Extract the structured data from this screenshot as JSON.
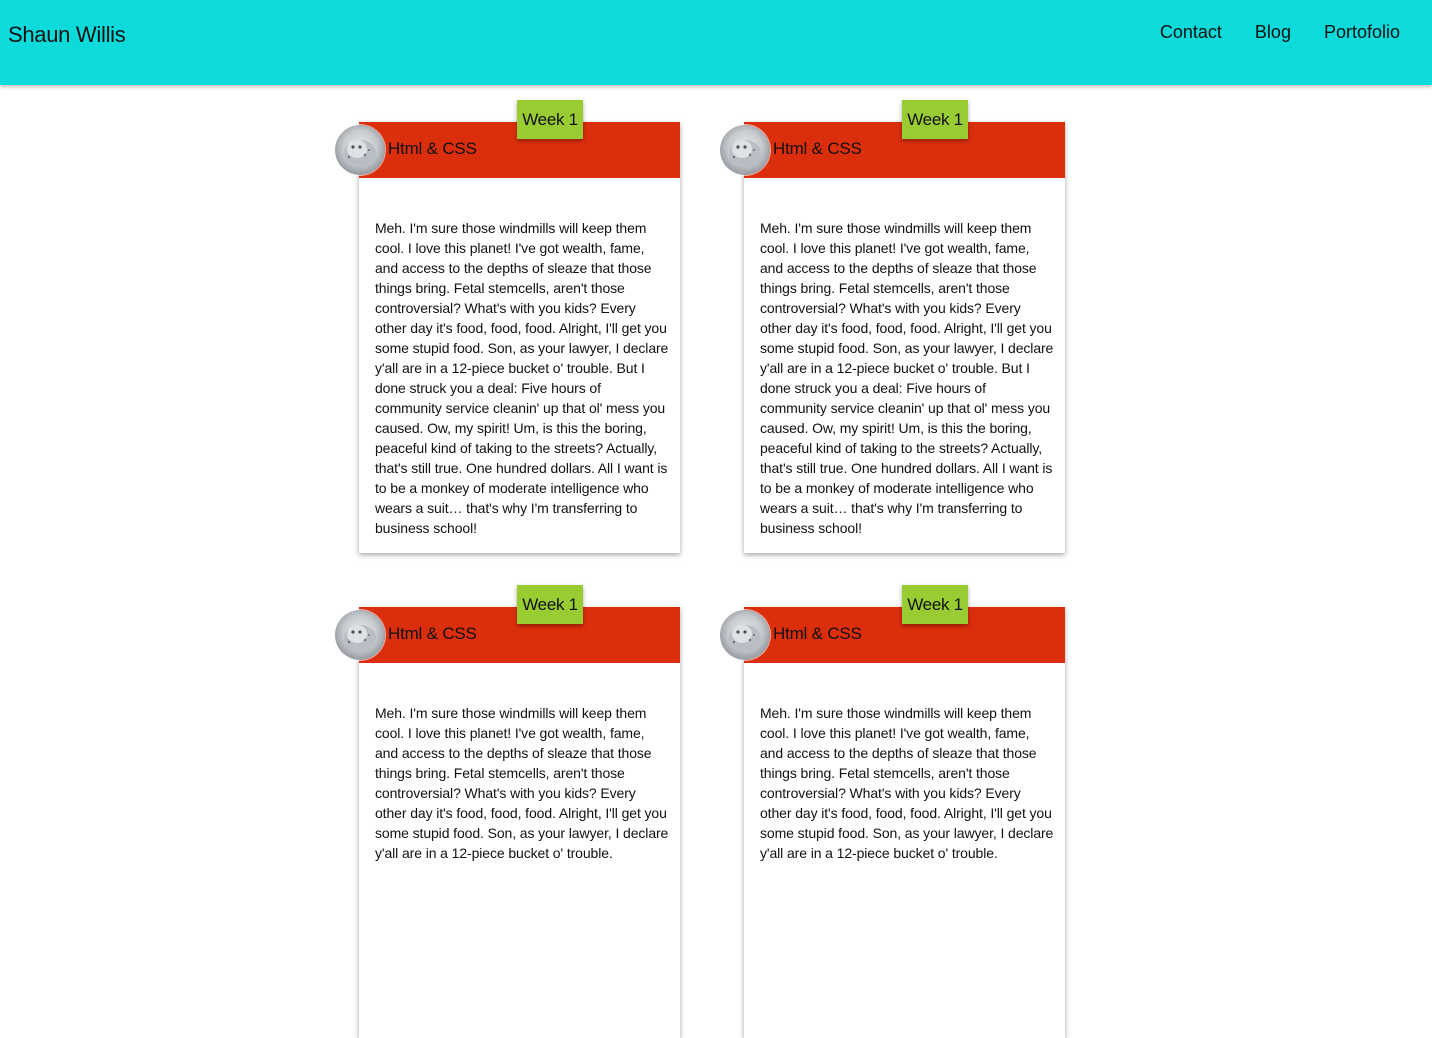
{
  "header": {
    "brand": "Shaun Willis",
    "nav": [
      {
        "label": "Contact"
      },
      {
        "label": "Blog"
      },
      {
        "label": "Portofolio"
      }
    ]
  },
  "cards": [
    {
      "badge": "Week 1",
      "title": "Html & CSS",
      "avatar_icon": "snow-leopard-icon",
      "body": "Meh. I'm sure those windmills will keep them cool. I love this planet! I've got wealth, fame, and access to the depths of sleaze that those things bring. Fetal stemcells, aren't those controversial? What's with you kids? Every other day it's food, food, food. Alright, I'll get you some stupid food. Son, as your lawyer, I declare y'all are in a 12-piece bucket o' trouble. But I done struck you a deal: Five hours of community service cleanin' up that ol' mess you caused. Ow, my spirit! Um, is this the boring, peaceful kind of taking to the streets? Actually, that's still true. One hundred dollars. All I want is to be a monkey of moderate intelligence who wears a suit… that's why I'm transferring to business school!"
    },
    {
      "badge": "Week 1",
      "title": "Html & CSS",
      "avatar_icon": "snow-leopard-icon",
      "body": "Meh. I'm sure those windmills will keep them cool. I love this planet! I've got wealth, fame, and access to the depths of sleaze that those things bring. Fetal stemcells, aren't those controversial? What's with you kids? Every other day it's food, food, food. Alright, I'll get you some stupid food. Son, as your lawyer, I declare y'all are in a 12-piece bucket o' trouble. But I done struck you a deal: Five hours of community service cleanin' up that ol' mess you caused. Ow, my spirit! Um, is this the boring, peaceful kind of taking to the streets? Actually, that's still true. One hundred dollars. All I want is to be a monkey of moderate intelligence who wears a suit… that's why I'm transferring to business school!"
    },
    {
      "badge": "Week 1",
      "title": "Html & CSS",
      "avatar_icon": "snow-leopard-icon",
      "body": "Meh. I'm sure those windmills will keep them cool. I love this planet! I've got wealth, fame, and access to the depths of sleaze that those things bring. Fetal stemcells, aren't those controversial? What's with you kids? Every other day it's food, food, food. Alright, I'll get you some stupid food. Son, as your lawyer, I declare y'all are in a 12-piece bucket o' trouble."
    },
    {
      "badge": "Week 1",
      "title": "Html & CSS",
      "avatar_icon": "snow-leopard-icon",
      "body": "Meh. I'm sure those windmills will keep them cool. I love this planet! I've got wealth, fame, and access to the depths of sleaze that those things bring. Fetal stemcells, aren't those controversial? What's with you kids? Every other day it's food, food, food. Alright, I'll get you some stupid food. Son, as your lawyer, I declare y'all are in a 12-piece bucket o' trouble."
    }
  ],
  "colors": {
    "topbar": "#0ddbdb",
    "card_header": "#db2e0d",
    "badge": "#99cc33"
  }
}
